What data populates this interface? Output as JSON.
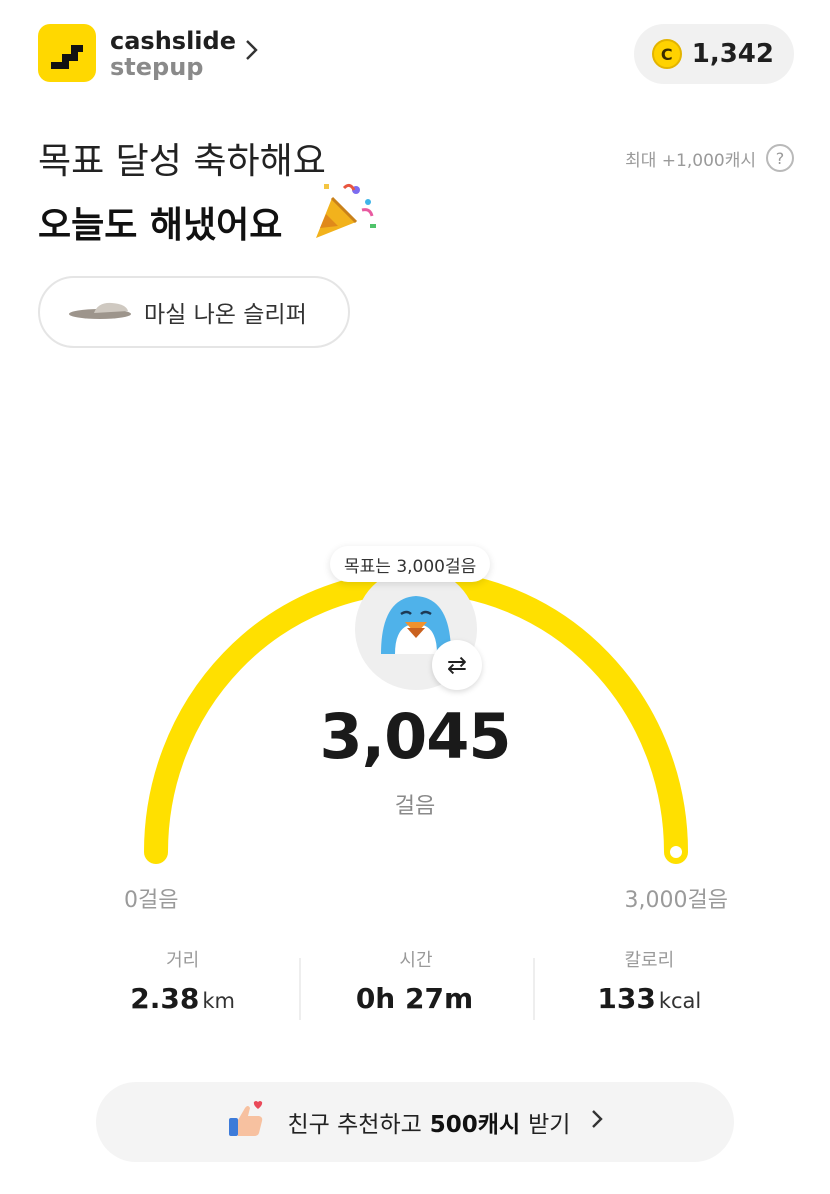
{
  "header": {
    "brand_line1": "cashslide",
    "brand_line2": "stepup",
    "cash_icon_letter": "C",
    "cash_balance": "1,342"
  },
  "hero": {
    "title_line1": "목표 달성 축하해요",
    "title_line2": "오늘도 해냈어요",
    "max_cash_text": "최대 +1,000캐시",
    "help_symbol": "?",
    "item_label": "마실 나온 슬리퍼"
  },
  "gauge": {
    "goal_tooltip": "목표는 3,000걸음",
    "steps": "3,045",
    "steps_unit": "걸음",
    "min_label": "0걸음",
    "max_label": "3,000걸음",
    "progress": 1.0,
    "swap_symbol": "⇄",
    "color": "#ffe000"
  },
  "stats": [
    {
      "label": "거리",
      "value": "2.38",
      "unit": "km"
    },
    {
      "label": "시간",
      "value": "0h 27m",
      "unit": ""
    },
    {
      "label": "칼로리",
      "value": "133",
      "unit": "kcal"
    }
  ],
  "invite": {
    "text_a": "친구 추천하고",
    "text_bold": "500캐시",
    "text_b": "받기"
  },
  "icons": [
    "cashslide-logo-icon",
    "chevron-right-icon",
    "coin-icon",
    "help-icon",
    "party-popper-icon",
    "slipper-icon",
    "penguin-avatar-icon",
    "swap-icon",
    "thumbs-up-icon"
  ]
}
